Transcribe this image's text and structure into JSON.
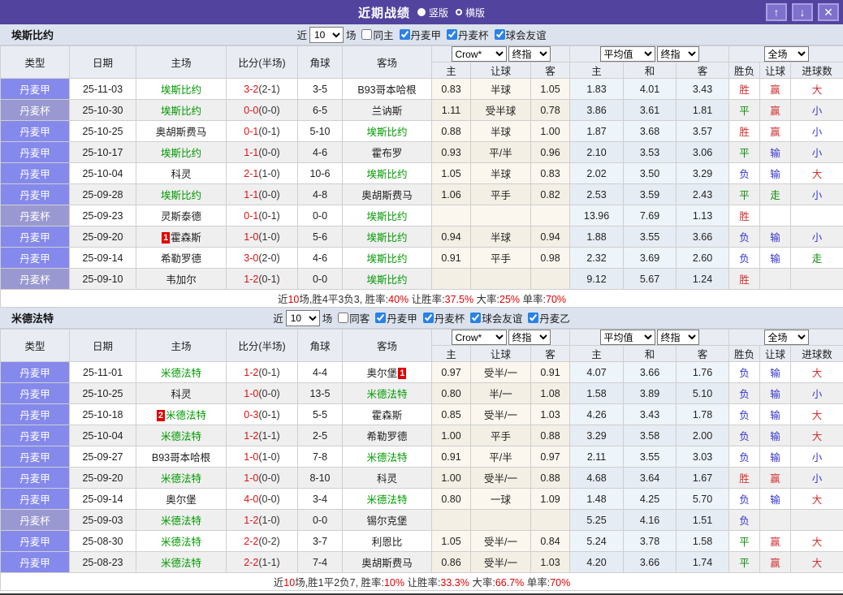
{
  "titlebar": {
    "title": "近期战绩",
    "vertical_label": "竖版",
    "horizontal_label": "横版",
    "up_icon": "↑",
    "down_icon": "↓",
    "close_icon": "✕",
    "bar_color": "#52449e"
  },
  "table_header": {
    "main": [
      "类型",
      "日期",
      "主场",
      "比分(半场)",
      "角球",
      "客场"
    ],
    "odds_selects": [
      "Crow*",
      "终指"
    ],
    "avg_selects": [
      "平均值",
      "终指"
    ],
    "period_select": "全场",
    "odds_sub": [
      "主",
      "让球",
      "客"
    ],
    "avg_sub": [
      "主",
      "和",
      "客"
    ],
    "result_sub": [
      "胜负",
      "让球",
      "进球数"
    ]
  },
  "colors": {
    "league_jia": "#8589ec",
    "league_bei": "#9a98d0",
    "team_green": "#009900",
    "score_red": "#dd1111",
    "win_red": "#d43030",
    "draw_green": "#0a8a0a",
    "lose_blue": "#3535cf"
  },
  "sections": [
    {
      "team": "埃斯比约",
      "filter": {
        "near": "近",
        "count": "10",
        "games": "场",
        "same": "同主",
        "same_checked": false,
        "leagues": [
          "丹麦甲",
          "丹麦杯",
          "球会友谊"
        ]
      },
      "rows": [
        {
          "type": "丹麦甲",
          "date": "25-11-03",
          "home": {
            "name": "埃斯比约",
            "green": true
          },
          "score": "3-2",
          "half": "(2-1)",
          "corner": "3-5",
          "away": {
            "name": "B93哥本哈根"
          },
          "odds": [
            "0.83",
            "半球",
            "1.05"
          ],
          "avg": [
            "1.83",
            "4.01",
            "3.43"
          ],
          "res": [
            {
              "t": "胜",
              "c": "r"
            },
            {
              "t": "赢",
              "c": "r"
            },
            {
              "t": "大",
              "c": "r"
            }
          ]
        },
        {
          "type": "丹麦杯",
          "date": "25-10-30",
          "home": {
            "name": "埃斯比约",
            "green": true
          },
          "score": "0-0",
          "half": "(0-0)",
          "corner": "6-5",
          "away": {
            "name": "兰讷斯"
          },
          "odds": [
            "1.11",
            "受半球",
            "0.78"
          ],
          "avg": [
            "3.86",
            "3.61",
            "1.81"
          ],
          "res": [
            {
              "t": "平",
              "c": "g"
            },
            {
              "t": "赢",
              "c": "r"
            },
            {
              "t": "小",
              "c": "b"
            }
          ]
        },
        {
          "type": "丹麦甲",
          "date": "25-10-25",
          "home": {
            "name": "奥胡斯费马"
          },
          "score": "0-1",
          "half": "(0-1)",
          "corner": "5-10",
          "away": {
            "name": "埃斯比约",
            "green": true
          },
          "odds": [
            "0.88",
            "半球",
            "1.00"
          ],
          "avg": [
            "1.87",
            "3.68",
            "3.57"
          ],
          "res": [
            {
              "t": "胜",
              "c": "r"
            },
            {
              "t": "赢",
              "c": "r"
            },
            {
              "t": "小",
              "c": "b"
            }
          ]
        },
        {
          "type": "丹麦甲",
          "date": "25-10-17",
          "home": {
            "name": "埃斯比约",
            "green": true
          },
          "score": "1-1",
          "half": "(0-0)",
          "corner": "4-6",
          "away": {
            "name": "霍布罗"
          },
          "odds": [
            "0.93",
            "平/半",
            "0.96"
          ],
          "avg": [
            "2.10",
            "3.53",
            "3.06"
          ],
          "res": [
            {
              "t": "平",
              "c": "g"
            },
            {
              "t": "输",
              "c": "b"
            },
            {
              "t": "小",
              "c": "b"
            }
          ]
        },
        {
          "type": "丹麦甲",
          "date": "25-10-04",
          "home": {
            "name": "科灵"
          },
          "score": "2-1",
          "half": "(1-0)",
          "corner": "10-6",
          "away": {
            "name": "埃斯比约",
            "green": true
          },
          "odds": [
            "1.05",
            "半球",
            "0.83"
          ],
          "avg": [
            "2.02",
            "3.50",
            "3.29"
          ],
          "res": [
            {
              "t": "负",
              "c": "b"
            },
            {
              "t": "输",
              "c": "b"
            },
            {
              "t": "大",
              "c": "r"
            }
          ]
        },
        {
          "type": "丹麦甲",
          "date": "25-09-28",
          "home": {
            "name": "埃斯比约",
            "green": true
          },
          "score": "1-1",
          "half": "(0-0)",
          "corner": "4-8",
          "away": {
            "name": "奥胡斯费马"
          },
          "odds": [
            "1.06",
            "平手",
            "0.82"
          ],
          "avg": [
            "2.53",
            "3.59",
            "2.43"
          ],
          "res": [
            {
              "t": "平",
              "c": "g"
            },
            {
              "t": "走",
              "c": "g"
            },
            {
              "t": "小",
              "c": "b"
            }
          ]
        },
        {
          "type": "丹麦杯",
          "date": "25-09-23",
          "home": {
            "name": "灵斯泰德"
          },
          "score": "0-1",
          "half": "(0-1)",
          "corner": "0-0",
          "away": {
            "name": "埃斯比约",
            "green": true
          },
          "odds": [
            "",
            "",
            ""
          ],
          "avg": [
            "13.96",
            "7.69",
            "1.13"
          ],
          "res": [
            {
              "t": "胜",
              "c": "r"
            },
            {
              "t": "",
              "c": "k"
            },
            {
              "t": "",
              "c": "k"
            }
          ]
        },
        {
          "type": "丹麦甲",
          "date": "25-09-20",
          "home": {
            "name": "霍森斯",
            "badge": "1",
            "badge_pos": "before"
          },
          "score": "1-0",
          "half": "(1-0)",
          "corner": "5-6",
          "away": {
            "name": "埃斯比约",
            "green": true
          },
          "odds": [
            "0.94",
            "半球",
            "0.94"
          ],
          "avg": [
            "1.88",
            "3.55",
            "3.66"
          ],
          "res": [
            {
              "t": "负",
              "c": "b"
            },
            {
              "t": "输",
              "c": "b"
            },
            {
              "t": "小",
              "c": "b"
            }
          ]
        },
        {
          "type": "丹麦甲",
          "date": "25-09-14",
          "home": {
            "name": "希勒罗德"
          },
          "score": "3-0",
          "half": "(2-0)",
          "corner": "4-6",
          "away": {
            "name": "埃斯比约",
            "green": true
          },
          "odds": [
            "0.91",
            "平手",
            "0.98"
          ],
          "avg": [
            "2.32",
            "3.69",
            "2.60"
          ],
          "res": [
            {
              "t": "负",
              "c": "b"
            },
            {
              "t": "输",
              "c": "b"
            },
            {
              "t": "走",
              "c": "g"
            }
          ]
        },
        {
          "type": "丹麦杯",
          "date": "25-09-10",
          "home": {
            "name": "韦加尔"
          },
          "score": "1-2",
          "half": "(0-1)",
          "corner": "0-0",
          "away": {
            "name": "埃斯比约",
            "green": true
          },
          "odds": [
            "",
            "",
            ""
          ],
          "avg": [
            "9.12",
            "5.67",
            "1.24"
          ],
          "res": [
            {
              "t": "胜",
              "c": "r"
            },
            {
              "t": "",
              "c": "k"
            },
            {
              "t": "",
              "c": "k"
            }
          ]
        }
      ],
      "summary": [
        {
          "t": "近",
          "c": "k"
        },
        {
          "t": "10",
          "c": "r"
        },
        {
          "t": "场,胜4平3负3, 胜率:",
          "c": "k"
        },
        {
          "t": "40%",
          "c": "r"
        },
        {
          "t": " 让胜率:",
          "c": "k"
        },
        {
          "t": "37.5%",
          "c": "r"
        },
        {
          "t": " 大率:",
          "c": "k"
        },
        {
          "t": "25%",
          "c": "r"
        },
        {
          "t": " 单率:",
          "c": "k"
        },
        {
          "t": "70%",
          "c": "r"
        }
      ]
    },
    {
      "team": "米德法特",
      "filter": {
        "near": "近",
        "count": "10",
        "games": "场",
        "same": "同客",
        "same_checked": false,
        "leagues": [
          "丹麦甲",
          "丹麦杯",
          "球会友谊",
          "丹麦乙"
        ]
      },
      "rows": [
        {
          "type": "丹麦甲",
          "date": "25-11-01",
          "home": {
            "name": "米德法特",
            "green": true
          },
          "score": "1-2",
          "half": "(0-1)",
          "corner": "4-4",
          "away": {
            "name": "奥尔堡",
            "badge": "1",
            "badge_pos": "after"
          },
          "odds": [
            "0.97",
            "受半/一",
            "0.91"
          ],
          "avg": [
            "4.07",
            "3.66",
            "1.76"
          ],
          "res": [
            {
              "t": "负",
              "c": "b"
            },
            {
              "t": "输",
              "c": "b"
            },
            {
              "t": "大",
              "c": "r"
            }
          ]
        },
        {
          "type": "丹麦甲",
          "date": "25-10-25",
          "home": {
            "name": "科灵"
          },
          "score": "1-0",
          "half": "(0-0)",
          "corner": "13-5",
          "away": {
            "name": "米德法特",
            "green": true
          },
          "odds": [
            "0.80",
            "半/一",
            "1.08"
          ],
          "avg": [
            "1.58",
            "3.89",
            "5.10"
          ],
          "res": [
            {
              "t": "负",
              "c": "b"
            },
            {
              "t": "输",
              "c": "b"
            },
            {
              "t": "小",
              "c": "b"
            }
          ]
        },
        {
          "type": "丹麦甲",
          "date": "25-10-18",
          "home": {
            "name": "米德法特",
            "green": true,
            "badge": "2",
            "badge_pos": "before"
          },
          "score": "0-3",
          "half": "(0-1)",
          "corner": "5-5",
          "away": {
            "name": "霍森斯"
          },
          "odds": [
            "0.85",
            "受半/一",
            "1.03"
          ],
          "avg": [
            "4.26",
            "3.43",
            "1.78"
          ],
          "res": [
            {
              "t": "负",
              "c": "b"
            },
            {
              "t": "输",
              "c": "b"
            },
            {
              "t": "大",
              "c": "r"
            }
          ]
        },
        {
          "type": "丹麦甲",
          "date": "25-10-04",
          "home": {
            "name": "米德法特",
            "green": true
          },
          "score": "1-2",
          "half": "(1-1)",
          "corner": "2-5",
          "away": {
            "name": "希勒罗德"
          },
          "odds": [
            "1.00",
            "平手",
            "0.88"
          ],
          "avg": [
            "3.29",
            "3.58",
            "2.00"
          ],
          "res": [
            {
              "t": "负",
              "c": "b"
            },
            {
              "t": "输",
              "c": "b"
            },
            {
              "t": "大",
              "c": "r"
            }
          ]
        },
        {
          "type": "丹麦甲",
          "date": "25-09-27",
          "home": {
            "name": "B93哥本哈根"
          },
          "score": "1-0",
          "half": "(1-0)",
          "corner": "7-8",
          "away": {
            "name": "米德法特",
            "green": true
          },
          "odds": [
            "0.91",
            "平/半",
            "0.97"
          ],
          "avg": [
            "2.11",
            "3.55",
            "3.03"
          ],
          "res": [
            {
              "t": "负",
              "c": "b"
            },
            {
              "t": "输",
              "c": "b"
            },
            {
              "t": "小",
              "c": "b"
            }
          ]
        },
        {
          "type": "丹麦甲",
          "date": "25-09-20",
          "home": {
            "name": "米德法特",
            "green": true
          },
          "score": "1-0",
          "half": "(0-0)",
          "corner": "8-10",
          "away": {
            "name": "科灵"
          },
          "odds": [
            "1.00",
            "受半/一",
            "0.88"
          ],
          "avg": [
            "4.68",
            "3.64",
            "1.67"
          ],
          "res": [
            {
              "t": "胜",
              "c": "r"
            },
            {
              "t": "赢",
              "c": "r"
            },
            {
              "t": "小",
              "c": "b"
            }
          ]
        },
        {
          "type": "丹麦甲",
          "date": "25-09-14",
          "home": {
            "name": "奥尔堡"
          },
          "score": "4-0",
          "half": "(0-0)",
          "corner": "3-4",
          "away": {
            "name": "米德法特",
            "green": true
          },
          "odds": [
            "0.80",
            "一球",
            "1.09"
          ],
          "avg": [
            "1.48",
            "4.25",
            "5.70"
          ],
          "res": [
            {
              "t": "负",
              "c": "b"
            },
            {
              "t": "输",
              "c": "b"
            },
            {
              "t": "大",
              "c": "r"
            }
          ]
        },
        {
          "type": "丹麦杯",
          "date": "25-09-03",
          "home": {
            "name": "米德法特",
            "green": true
          },
          "score": "1-2",
          "half": "(1-0)",
          "corner": "0-0",
          "away": {
            "name": "锡尔克堡"
          },
          "odds": [
            "",
            "",
            ""
          ],
          "avg": [
            "5.25",
            "4.16",
            "1.51"
          ],
          "res": [
            {
              "t": "负",
              "c": "b"
            },
            {
              "t": "",
              "c": "k"
            },
            {
              "t": "",
              "c": "k"
            }
          ]
        },
        {
          "type": "丹麦甲",
          "date": "25-08-30",
          "home": {
            "name": "米德法特",
            "green": true
          },
          "score": "2-2",
          "half": "(0-2)",
          "corner": "3-7",
          "away": {
            "name": "利恩比"
          },
          "odds": [
            "1.05",
            "受半/一",
            "0.84"
          ],
          "avg": [
            "5.24",
            "3.78",
            "1.58"
          ],
          "res": [
            {
              "t": "平",
              "c": "g"
            },
            {
              "t": "赢",
              "c": "r"
            },
            {
              "t": "大",
              "c": "r"
            }
          ]
        },
        {
          "type": "丹麦甲",
          "date": "25-08-23",
          "home": {
            "name": "米德法特",
            "green": true
          },
          "score": "2-2",
          "half": "(1-1)",
          "corner": "7-4",
          "away": {
            "name": "奥胡斯费马"
          },
          "odds": [
            "0.86",
            "受半/一",
            "1.03"
          ],
          "avg": [
            "4.20",
            "3.66",
            "1.74"
          ],
          "res": [
            {
              "t": "平",
              "c": "g"
            },
            {
              "t": "赢",
              "c": "r"
            },
            {
              "t": "大",
              "c": "r"
            }
          ]
        }
      ],
      "summary": [
        {
          "t": "近",
          "c": "k"
        },
        {
          "t": "10",
          "c": "r"
        },
        {
          "t": "场,胜1平2负7, 胜率:",
          "c": "k"
        },
        {
          "t": "10%",
          "c": "r"
        },
        {
          "t": " 让胜率:",
          "c": "k"
        },
        {
          "t": "33.3%",
          "c": "r"
        },
        {
          "t": " 大率:",
          "c": "k"
        },
        {
          "t": "66.7%",
          "c": "r"
        },
        {
          "t": " 单率:",
          "c": "k"
        },
        {
          "t": "70%",
          "c": "r"
        }
      ]
    }
  ]
}
